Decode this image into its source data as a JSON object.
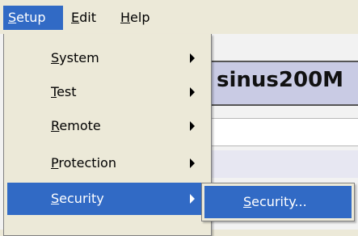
{
  "menubar": {
    "items": [
      {
        "label": "Setup",
        "mnemonic": "S",
        "rest": "etup",
        "active": true
      },
      {
        "label": "Edit",
        "mnemonic": "E",
        "rest": "dit",
        "active": false
      },
      {
        "label": "Help",
        "mnemonic": "H",
        "rest": "elp",
        "active": false
      }
    ]
  },
  "app": {
    "title": "sinus200M"
  },
  "dropdown": {
    "items": [
      {
        "label": "System",
        "mnemonic": "S",
        "rest": "ystem",
        "has_submenu": true
      },
      {
        "label": "Test",
        "mnemonic": "T",
        "rest": "est",
        "has_submenu": true
      },
      {
        "label": "Remote",
        "mnemonic": "R",
        "rest": "emote",
        "has_submenu": true
      },
      {
        "label": "Protection",
        "mnemonic": "P",
        "rest": "rotection",
        "has_submenu": true
      },
      {
        "label": "Security",
        "mnemonic": "S",
        "rest": "ecurity",
        "has_submenu": true,
        "active": true
      }
    ]
  },
  "submenu": {
    "items": [
      {
        "label": "Security...",
        "mnemonic": "S",
        "rest": "ecurity..."
      }
    ]
  },
  "colors": {
    "menu_bg": "#ece9d8",
    "highlight": "#316ac5",
    "title_bg": "#c9cbe4"
  }
}
